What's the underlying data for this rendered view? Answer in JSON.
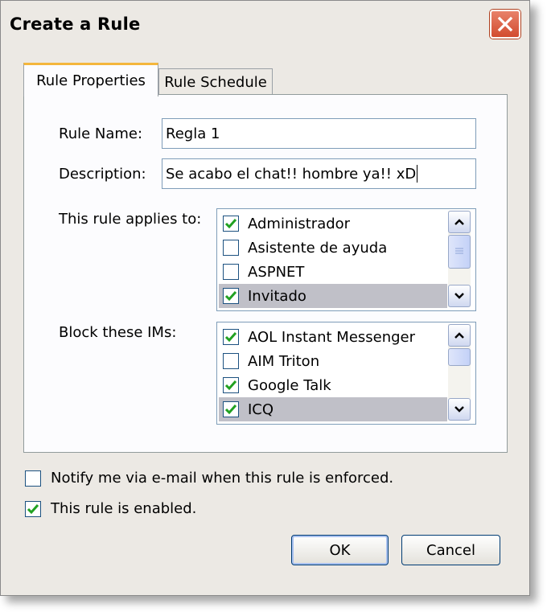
{
  "window": {
    "title": "Create a Rule"
  },
  "tabs": [
    {
      "label": "Rule Properties",
      "active": true
    },
    {
      "label": "Rule Schedule",
      "active": false
    }
  ],
  "fields": {
    "rule_name": {
      "label": "Rule Name:",
      "value": "Regla 1"
    },
    "description": {
      "label": "Description:",
      "value": "Se acabo el chat!! hombre ya!! xD"
    }
  },
  "applies_to": {
    "label": "This rule applies to:",
    "items": [
      {
        "label": "Administrador",
        "checked": true,
        "selected": false
      },
      {
        "label": "Asistente de ayuda",
        "checked": false,
        "selected": false
      },
      {
        "label": "ASPNET",
        "checked": false,
        "selected": false
      },
      {
        "label": "Invitado",
        "checked": true,
        "selected": true
      }
    ]
  },
  "block_ims": {
    "label": "Block these IMs:",
    "items": [
      {
        "label": "AOL Instant Messenger",
        "checked": true,
        "selected": false
      },
      {
        "label": "AIM Triton",
        "checked": false,
        "selected": false
      },
      {
        "label": "Google Talk",
        "checked": true,
        "selected": false
      },
      {
        "label": "ICQ",
        "checked": true,
        "selected": true
      }
    ]
  },
  "options": {
    "notify": {
      "label": "Notify me via e-mail when this rule is enforced.",
      "checked": false
    },
    "enabled": {
      "label": "This rule is enabled.",
      "checked": true
    }
  },
  "buttons": {
    "ok": "OK",
    "cancel": "Cancel"
  },
  "icons": {
    "close": "close-icon",
    "check": "checkmark-icon",
    "scroll_up": "scroll-up-arrow-icon",
    "scroll_down": "scroll-down-arrow-icon"
  },
  "colors": {
    "checkmark": "#21a121",
    "close_button": "#d24b2f",
    "tab_highlight": "#f4b63c"
  }
}
